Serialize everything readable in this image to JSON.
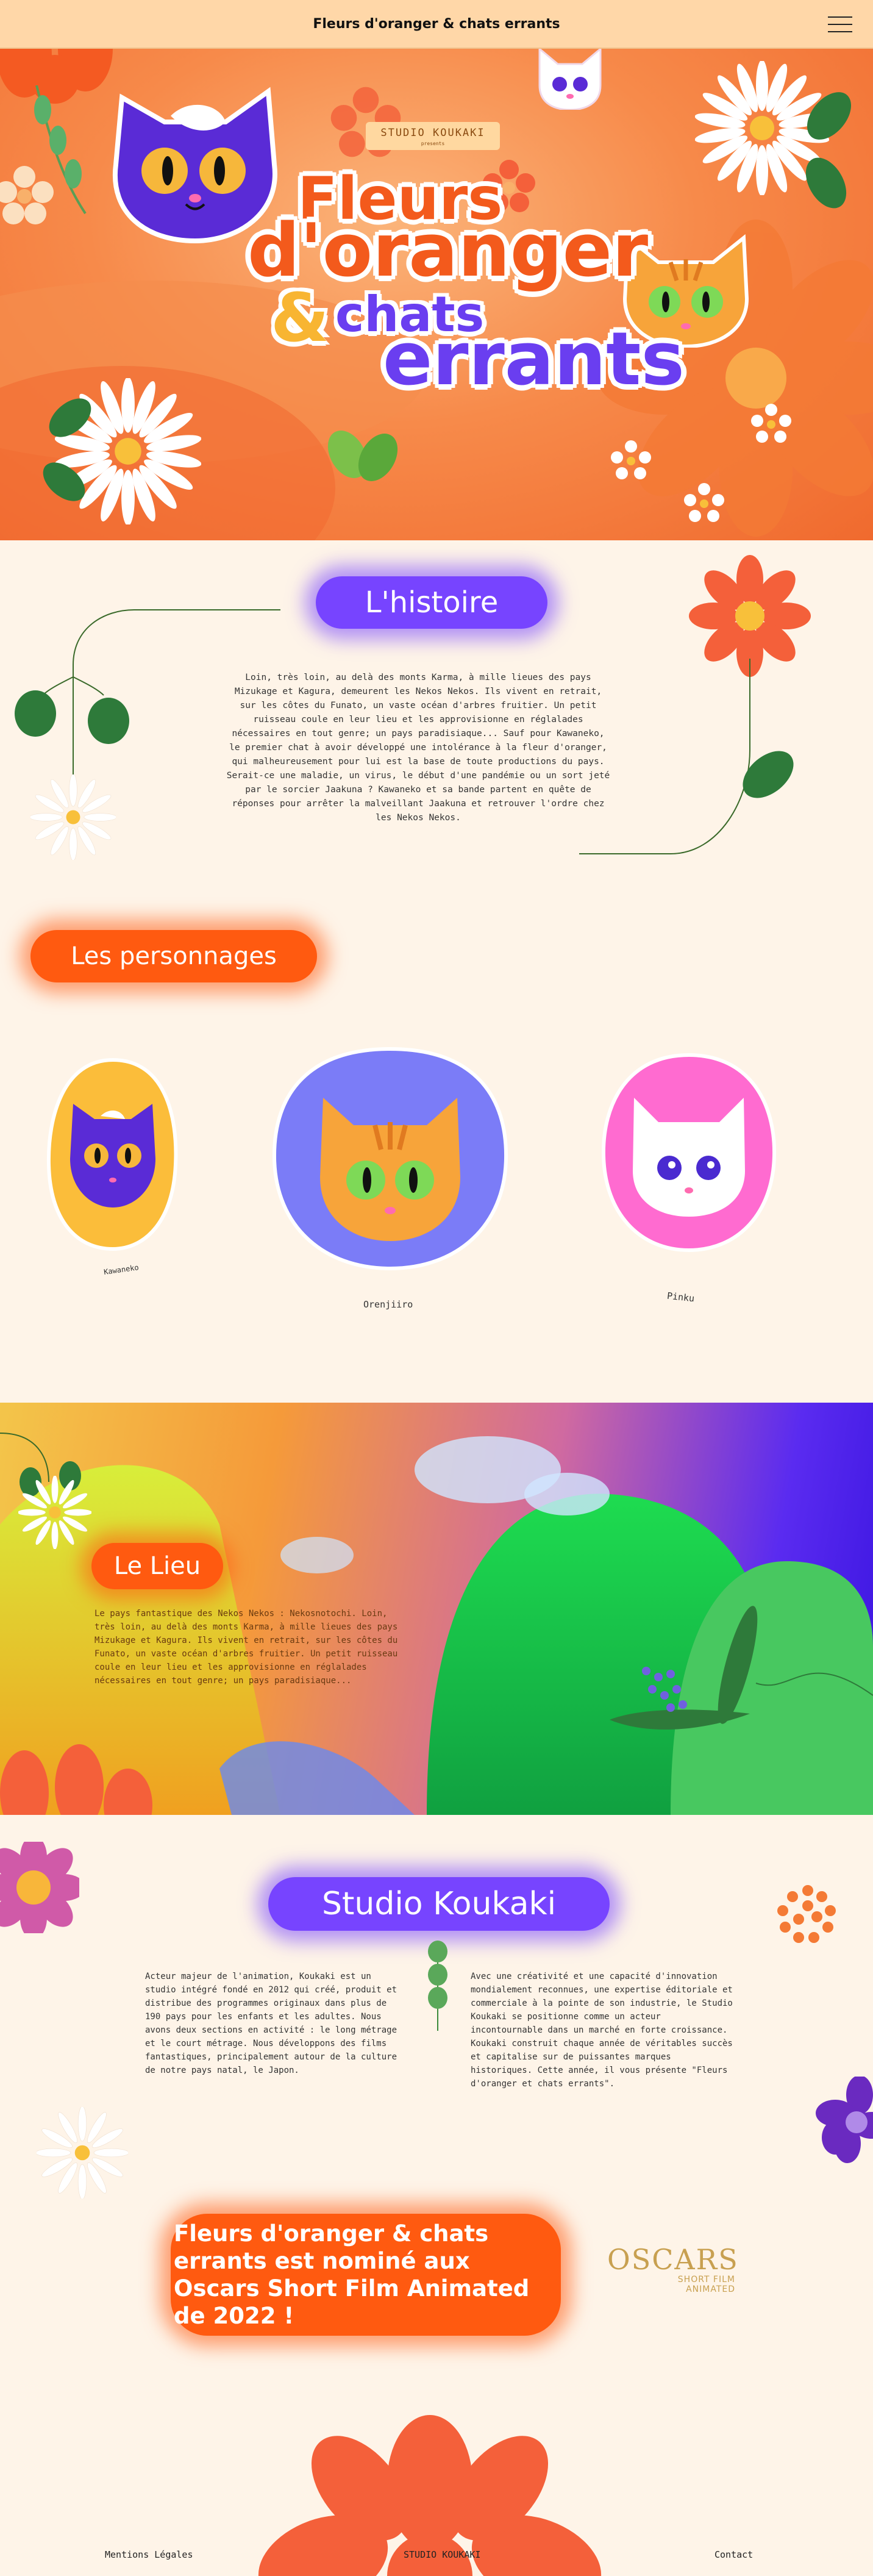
{
  "header": {
    "title": "Fleurs d'oranger & chats errants",
    "menu_icon": "hamburger-icon"
  },
  "hero": {
    "studio_name": "STUDIO KOUKAKI",
    "studio_sub": "presents",
    "title_line1": "Fleurs",
    "title_line2": "d'oranger",
    "title_amp": "&",
    "title_line3": "chats",
    "title_line4": "errants"
  },
  "histoire": {
    "heading": "L'histoire",
    "text": "Loin, très loin, au delà des monts Karma, à mille lieues des pays Mizukage et Kagura, demeurent les Nekos Nekos. Ils vivent en retrait, sur les côtes du Funato, un vaste océan d'arbres fruitier. Un petit ruisseau coule en leur lieu et les approvisionne en réglalades nécessaires en tout genre; un pays paradisiaque... Sauf pour Kawaneko, le premier chat à avoir développé une intolérance à la fleur d'oranger, qui malheureusement pour lui est la base de toute productions du pays. Serait-ce une maladie, un virus, le début d'une pandémie ou un sort jeté par le sorcier Jaakuna ? Kawaneko et sa bande partent en quête de réponses pour arrêter la malveillant Jaakuna et retrouver l'ordre chez les Nekos Nekos."
  },
  "personnages": {
    "heading": "Les personnages",
    "characters": [
      {
        "name": "Kawaneko",
        "bg": "#fbbd3a"
      },
      {
        "name": "Orenjiiro",
        "bg": "#7b7cf7"
      },
      {
        "name": "Pinku",
        "bg": "#ff6bd0"
      }
    ]
  },
  "lieu": {
    "heading": "Le Lieu",
    "text": "Le pays fantastique des Nekos Nekos : Nekosnotochi. Loin, très loin, au delà des monts Karma, à mille lieues des pays Mizukage et Kagura. Ils vivent en retrait, sur les côtes du Funato, un vaste océan d'arbres fruitier. Un petit ruisseau coule en leur lieu et les approvisionne en réglalades nécessaires en tout genre; un pays paradisiaque..."
  },
  "studio": {
    "heading": "Studio Koukaki",
    "col1": "Acteur majeur de l'animation, Koukaki est un studio intégré fondé en 2012 qui créé, produit et distribue des programmes originaux dans plus de 190 pays pour les enfants et les adultes. Nous avons deux sections en activité : le long métrage et le court métrage. Nous développons des films fantastiques, principalement autour de la culture de notre pays natal, le Japon.",
    "col2": "Avec une créativité et une capacité d'innovation mondialement reconnues, une expertise éditoriale et commerciale à la pointe de son industrie, le Studio Koukaki se positionne comme un acteur incontournable dans un marché en forte croissance. Koukaki construit chaque année de véritables succès et capitalise sur de puissantes marques historiques. Cette année, il vous présente \"Fleurs d'oranger et chats errants\"."
  },
  "oscars": {
    "text": "Fleurs d'oranger & chats errants est nominé aux Oscars Short Film Animated de 2022 !",
    "logo_title": "OSCARS",
    "logo_line1": "SHORT FILM",
    "logo_line2": "ANIMATED"
  },
  "footer": {
    "legal": "Mentions Légales",
    "studio": "STUDIO KOUKAKI",
    "contact": "Contact"
  },
  "colors": {
    "orange": "#ff5a10",
    "purple": "#7744ff",
    "cream": "#fef4e8",
    "header": "#ffd7a8"
  }
}
